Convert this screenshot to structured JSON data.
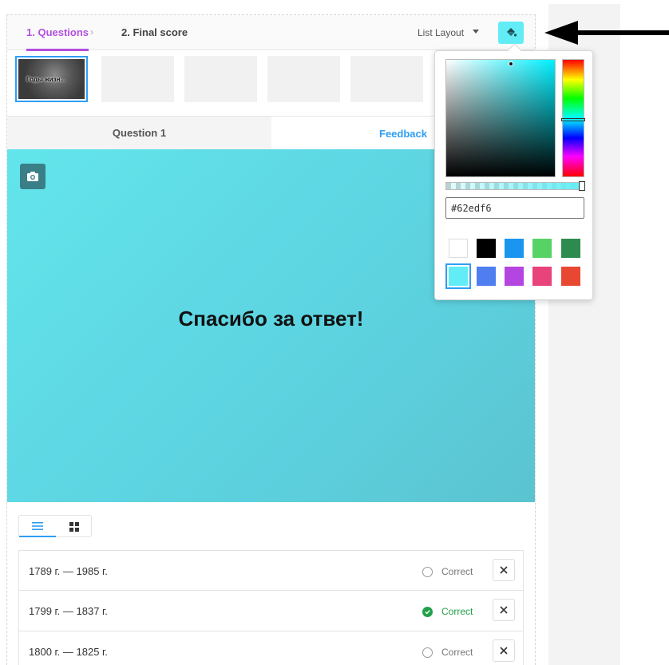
{
  "background_text": "",
  "breadcrumb": {
    "step1": "1. Questions",
    "separator": "›",
    "step2": "2. Final score"
  },
  "toolbar": {
    "layout_label": "List Layout",
    "paint_icon": "paint-bucket-icon"
  },
  "thumbnails": {
    "selected_caption": "Годы жизн..."
  },
  "tabs": {
    "question": "Question 1",
    "feedback": "Feedback"
  },
  "feedback": {
    "message": "Спасибо за ответ!",
    "background_color": "#62edf6"
  },
  "color_picker": {
    "hex_value": "#62edf6",
    "swatches": [
      "#ffffff",
      "#000000",
      "#1a96f0",
      "#56d364",
      "#2e8b4f",
      "#62edf6",
      "#4f7ef0",
      "#b545e0",
      "#e8437a",
      "#e84832"
    ],
    "selected_swatch": "#62edf6"
  },
  "answers": [
    {
      "text": "1789 г. — 1985 г.",
      "correct_label": "Correct",
      "is_correct": false
    },
    {
      "text": "1799 г. — 1837 г.",
      "correct_label": "Correct",
      "is_correct": true
    },
    {
      "text": "1800 г. — 1825 г.",
      "correct_label": "Correct",
      "is_correct": false
    }
  ],
  "colors": {
    "accent_purple": "#b34ee0",
    "accent_blue": "#2e9ef4",
    "correct_green": "#21a04a"
  }
}
